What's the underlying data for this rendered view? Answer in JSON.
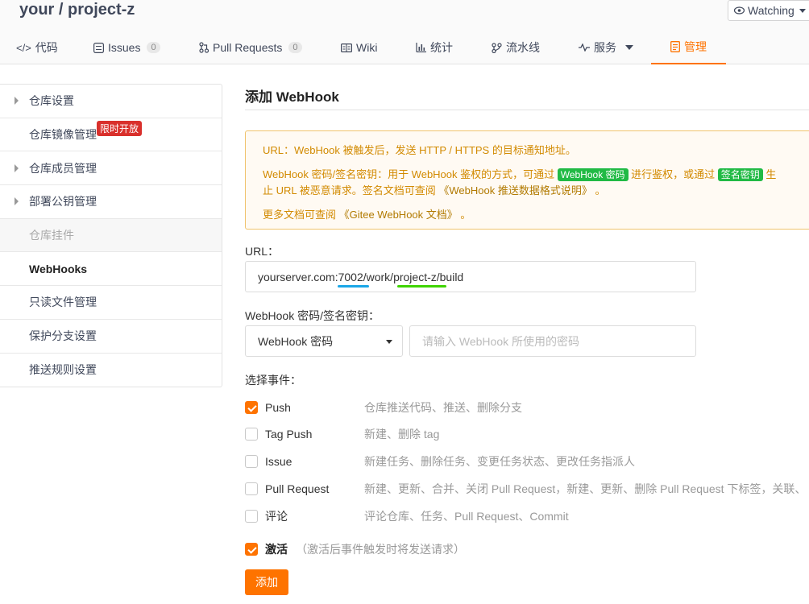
{
  "header": {
    "repo_title": "your / project-z",
    "watch_label": "Watching"
  },
  "tabs": [
    {
      "icon": "code-icon",
      "label": "代码"
    },
    {
      "icon": "issues-icon",
      "label": "Issues",
      "count": "0"
    },
    {
      "icon": "pull-request-icon",
      "label": "Pull Requests",
      "count": "0"
    },
    {
      "icon": "wiki-icon",
      "label": "Wiki"
    },
    {
      "icon": "stats-icon",
      "label": "统计"
    },
    {
      "icon": "pipeline-icon",
      "label": "流水线"
    },
    {
      "icon": "services-icon",
      "label": "服务"
    },
    {
      "icon": "manage-icon",
      "label": "管理"
    }
  ],
  "sidebar": {
    "items": [
      {
        "label": "仓库设置"
      },
      {
        "label": "仓库镜像管理",
        "badge": "限时开放"
      },
      {
        "label": "仓库成员管理"
      },
      {
        "label": "部署公钥管理"
      },
      {
        "label": "仓库挂件"
      },
      {
        "label": "WebHooks"
      },
      {
        "label": "只读文件管理"
      },
      {
        "label": "保护分支设置"
      },
      {
        "label": "推送规则设置"
      }
    ]
  },
  "main": {
    "title": "添加 WebHook",
    "notice": {
      "line1": "URL：WebHook 被触发后，发送 HTTP / HTTPS 的目标通知地址。",
      "line2_prefix": "WebHook 密码/签名密钥：用于 WebHook 鉴权的方式，可通过 ",
      "tag_password": "WebHook 密码",
      "line2_mid": " 进行鉴权，或通过 ",
      "tag_signature": "签名密钥",
      "line2_suffix": " 生",
      "line3": "止 URL 被恶意请求。签名文档可查阅 ",
      "line3_link": "《WebHook 推送数据格式说明》",
      "line3_end": " 。",
      "line4": "更多文档可查阅 ",
      "line4_link": "《Gitee WebHook 文档》",
      "line4_end": " 。"
    },
    "url_label": "URL：",
    "url_value": "yourserver.com:7002/work/project-z/build",
    "secret_label": "WebHook 密码/签名密钥：",
    "secret_type": "WebHook 密码",
    "secret_placeholder": "请输入 WebHook 所使用的密码",
    "events_label": "选择事件：",
    "events": [
      {
        "name": "Push",
        "desc": "仓库推送代码、推送、删除分支",
        "checked": true
      },
      {
        "name": "Tag Push",
        "desc": "新建、删除 tag",
        "checked": false
      },
      {
        "name": "Issue",
        "desc": "新建任务、删除任务、变更任务状态、更改任务指派人",
        "checked": false
      },
      {
        "name": "Pull Request",
        "desc": "新建、更新、合并、关闭 Pull Request，新建、更新、删除 Pull Request 下标签，关联、",
        "checked": false
      },
      {
        "name": "评论",
        "desc": "评论仓库、任务、Pull Request、Commit",
        "checked": false
      }
    ],
    "activate_label": "激活",
    "activate_hint": "（激活后事件触发时将发送请求）",
    "activate_checked": true,
    "add_button": "添加"
  },
  "colors": {
    "accent": "#fe7300",
    "notice_text": "#d28a00",
    "green_tag": "#21ba45",
    "red_badge": "#d9302c",
    "annotation_blue": "#1aa7e8",
    "annotation_green": "#3fd400"
  }
}
